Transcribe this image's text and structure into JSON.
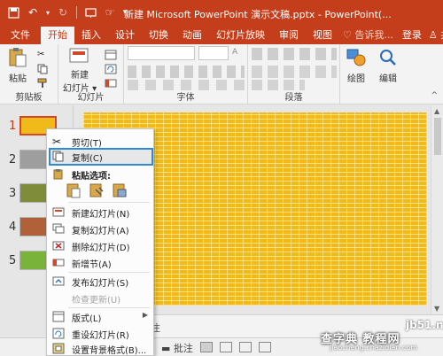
{
  "window": {
    "title": "新建 Microsoft PowerPoint 演示文稿.pptx - PowerPoint(..."
  },
  "tabs": [
    {
      "label": "文件"
    },
    {
      "label": "开始"
    },
    {
      "label": "插入"
    },
    {
      "label": "设计"
    },
    {
      "label": "切换"
    },
    {
      "label": "动画"
    },
    {
      "label": "幻灯片放映"
    },
    {
      "label": "审阅"
    },
    {
      "label": "视图"
    }
  ],
  "tabs_right": {
    "tell": "告诉我...",
    "login": "登录",
    "share": "共享"
  },
  "ribbon": {
    "paste_label": "粘贴",
    "new_slide_label_1": "新建",
    "new_slide_label_2": "幻灯片",
    "draw_label": "绘图",
    "edit_label": "编辑",
    "groups": {
      "clipboard": "剪贴板",
      "slides": "幻灯片",
      "font": "字体",
      "paragraph": "段落"
    }
  },
  "thumbnails": [
    {
      "num": "1",
      "color": "#f0bb1a"
    },
    {
      "num": "2",
      "color": "#9e9e9e"
    },
    {
      "num": "3",
      "color": "#7f8c3a"
    },
    {
      "num": "4",
      "color": "#b0613a"
    },
    {
      "num": "5",
      "color": "#7ab33a"
    }
  ],
  "context_menu": {
    "cut": "剪切(T)",
    "copy": "复制(C)",
    "paste_options": "粘贴选项:",
    "new_slide": "新建幻灯片(N)",
    "duplicate_slide": "复制幻灯片(A)",
    "delete_slide": "删除幻灯片(D)",
    "new_section": "新增节(A)",
    "publish_slides": "发布幻灯片(S)",
    "check_updates": "检查更新(U)",
    "layout": "版式(L)",
    "reset_slide": "重设幻灯片(R)",
    "format_background": "设置背景格式(B)..."
  },
  "notes": {
    "text": "注"
  },
  "statusbar": {
    "comments": "批注"
  },
  "watermark": {
    "site": "jb51.net",
    "cn": "查字典 教程网",
    "url": "jiaocheng.chazidian.com"
  },
  "colors": {
    "brand": "#c43e1c",
    "highlight_border": "#2e8ad8",
    "slide_fill": "#f0bb1a"
  }
}
